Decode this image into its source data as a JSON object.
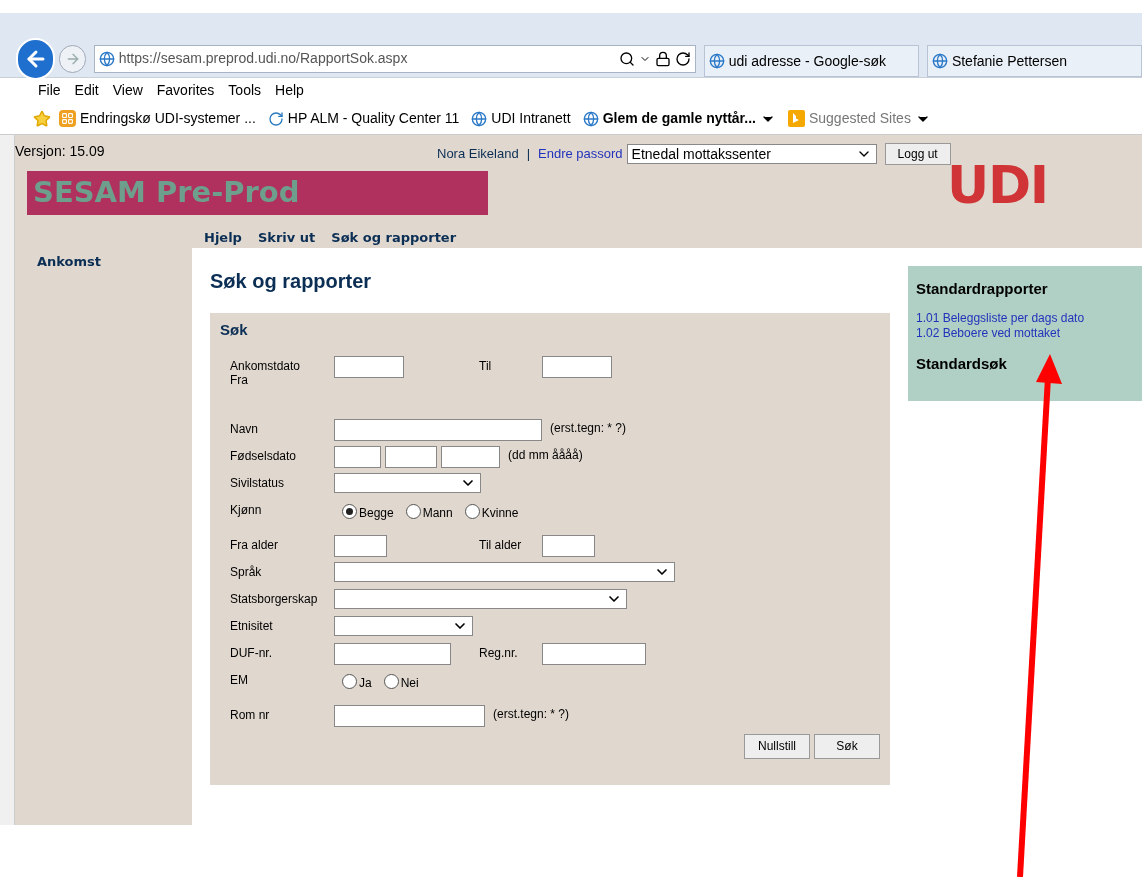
{
  "browser": {
    "address": "https://sesam.preprod.udi.no/RapportSok.aspx",
    "tabs": [
      {
        "label": "udi adresse - Google-søk",
        "selected": false
      },
      {
        "label": "Stefanie Pettersen",
        "selected": false
      }
    ],
    "menu": [
      "File",
      "Edit",
      "View",
      "Favorites",
      "Tools",
      "Help"
    ],
    "favorites": [
      {
        "label": "Endringskø UDI-systemer ...",
        "kind": "orange",
        "bold": false,
        "dropdown": false
      },
      {
        "label": "HP ALM - Quality Center 11",
        "kind": "swirl",
        "bold": false,
        "dropdown": false
      },
      {
        "label": "UDI Intranett",
        "kind": "ie",
        "bold": false,
        "dropdown": false
      },
      {
        "label": "Glem de gamle nyttår...",
        "kind": "ie",
        "bold": true,
        "dropdown": true
      },
      {
        "label": "Suggested Sites",
        "kind": "bing",
        "bold": false,
        "dropdown": true
      }
    ]
  },
  "header": {
    "version": "Versjon: 15.09",
    "user": "Nora Eikeland",
    "separator": "|",
    "change_password": "Endre passord",
    "location": "Etnedal mottakssenter",
    "logout": "Logg ut",
    "banner": "SESAM Pre-Prod",
    "logo": "UDI",
    "nav": [
      "Hjelp",
      "Skriv ut",
      "Søk og rapporter"
    ]
  },
  "sidebar": {
    "items": [
      "Ankomst"
    ]
  },
  "page_title": "Søk og rapporter",
  "form": {
    "title": "Søk",
    "rows": [
      {
        "label": "Ankomstdato Fra",
        "kind": "tall",
        "controls": [
          {
            "kind": "input"
          }
        ],
        "right": {
          "label": "Til",
          "controls": [
            {
              "kind": "input"
            }
          ]
        }
      },
      {
        "label": "Navn",
        "kind": "plain",
        "controls": [
          {
            "kind": "input"
          },
          {
            "kind": "hint",
            "text": "(erst.tegn: * ?)"
          }
        ]
      },
      {
        "label": "Fødselsdato",
        "kind": "plain",
        "controls": [
          {
            "kind": "input"
          },
          {
            "kind": "input"
          },
          {
            "kind": "input"
          },
          {
            "kind": "hint",
            "text": "(dd mm åååå)"
          }
        ]
      },
      {
        "label": "Sivilstatus",
        "kind": "plain",
        "controls": [
          {
            "kind": "select"
          }
        ]
      },
      {
        "label": "Kjønn",
        "kind": "radio",
        "controls": [
          {
            "kind": "radio",
            "label": "Begge",
            "selected": true
          },
          {
            "kind": "radio",
            "label": "Mann",
            "selected": false
          },
          {
            "kind": "radio",
            "label": "Kvinne",
            "selected": false
          }
        ]
      },
      {
        "label": "Fra alder",
        "kind": "plain",
        "controls": [
          {
            "kind": "input"
          }
        ],
        "right": {
          "label": "Til alder",
          "controls": [
            {
              "kind": "input"
            }
          ]
        }
      },
      {
        "label": "Språk",
        "kind": "plain",
        "controls": [
          {
            "kind": "select"
          }
        ]
      },
      {
        "label": "Statsborgerskap",
        "kind": "plain",
        "controls": [
          {
            "kind": "select"
          }
        ]
      },
      {
        "label": "Etnisitet",
        "kind": "plain",
        "controls": [
          {
            "kind": "select"
          }
        ]
      },
      {
        "label": "DUF-nr.",
        "kind": "plain",
        "controls": [
          {
            "kind": "input"
          }
        ],
        "right": {
          "label": "Reg.nr.",
          "controls": [
            {
              "kind": "input"
            }
          ]
        }
      },
      {
        "label": "EM",
        "kind": "radio",
        "controls": [
          {
            "kind": "radio",
            "label": "Ja",
            "selected": false
          },
          {
            "kind": "radio",
            "label": "Nei",
            "selected": false
          }
        ]
      },
      {
        "label": "Rom nr",
        "kind": "plain",
        "controls": [
          {
            "kind": "input"
          },
          {
            "kind": "hint",
            "text": "(erst.tegn: * ?)"
          }
        ]
      }
    ],
    "buttons": [
      "Nullstill",
      "Søk"
    ]
  },
  "reports": {
    "title": "Standardrapporter",
    "links": [
      "1.01 Beleggsliste per dags dato",
      "1.02 Beboere ved mottaket"
    ],
    "search_title": "Standardsøk"
  }
}
